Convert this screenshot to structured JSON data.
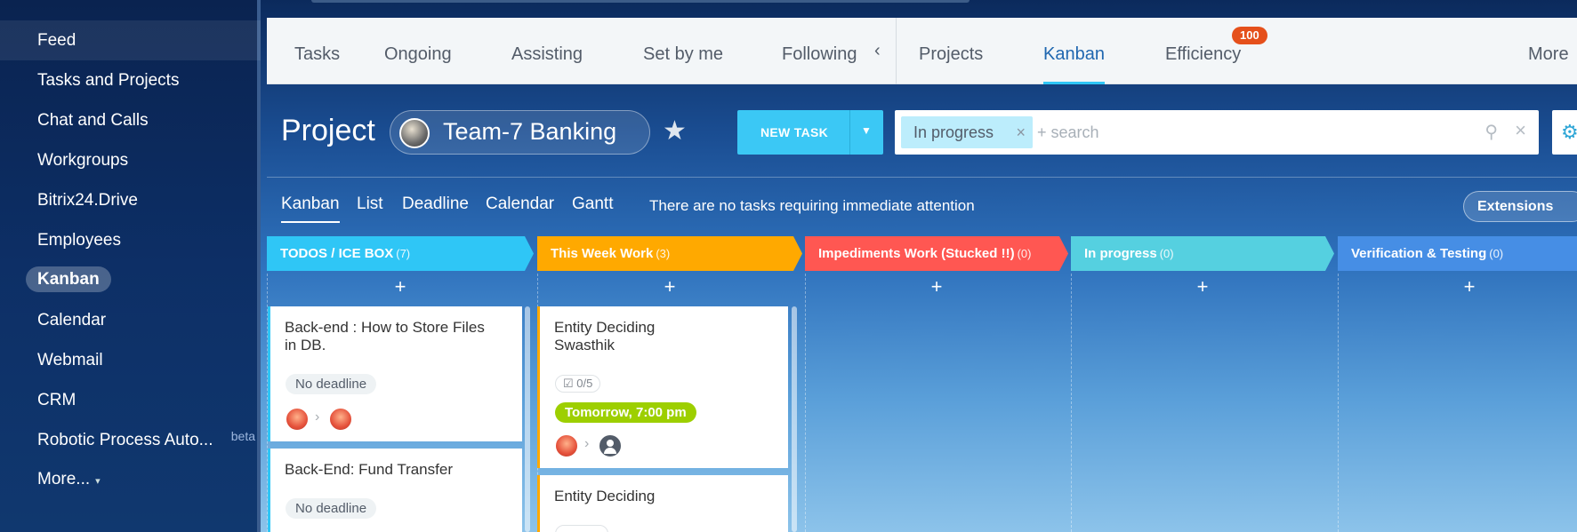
{
  "sidebar": {
    "items": [
      {
        "label": "Feed"
      },
      {
        "label": "Tasks and Projects"
      },
      {
        "label": "Chat and Calls"
      },
      {
        "label": "Workgroups"
      },
      {
        "label": "Bitrix24.Drive"
      },
      {
        "label": "Employees"
      },
      {
        "label": "Kanban"
      },
      {
        "label": "Calendar"
      },
      {
        "label": "Webmail"
      },
      {
        "label": "CRM"
      },
      {
        "label": "Robotic Process Auto...",
        "badge": "beta"
      },
      {
        "label": "More..."
      }
    ]
  },
  "topnav": {
    "tabs": [
      {
        "label": "Tasks"
      },
      {
        "label": "Ongoing"
      },
      {
        "label": "Assisting"
      },
      {
        "label": "Set by me"
      },
      {
        "label": "Following"
      },
      {
        "label": "Projects"
      },
      {
        "label": "Kanban"
      },
      {
        "label": "Efficiency"
      },
      {
        "label": "More"
      }
    ],
    "efficiency_badge": "100"
  },
  "header": {
    "title": "Project",
    "project_name": "Team-7 Banking",
    "new_task_label": "NEW TASK",
    "filter_chip": "In progress",
    "search_placeholder": "+ search"
  },
  "views": {
    "tabs": [
      {
        "label": "Kanban"
      },
      {
        "label": "List"
      },
      {
        "label": "Deadline"
      },
      {
        "label": "Calendar"
      },
      {
        "label": "Gantt"
      }
    ],
    "attention_text": "There are no tasks requiring immediate attention",
    "extensions_label": "Extensions"
  },
  "kanban": {
    "columns": [
      {
        "title": "TODOS / ICE BOX",
        "count": "(7)",
        "color": "#2fc6f6"
      },
      {
        "title": "This Week Work",
        "count": "(3)",
        "color": "#ffa900"
      },
      {
        "title": "Impediments Work (Stucked !!)",
        "count": "(0)",
        "color": "#ff5752"
      },
      {
        "title": "In progress",
        "count": "(0)",
        "color": "#55d0e0"
      },
      {
        "title": "Verification & Testing",
        "count": "(0)",
        "color": "#468ee5"
      }
    ],
    "add_symbol": "+",
    "cards": {
      "todo": [
        {
          "title": "Back-end : How to Store Files in DB.",
          "deadline": "No deadline"
        },
        {
          "title": "Back-End: Fund Transfer",
          "deadline": "No deadline"
        }
      ],
      "week": [
        {
          "title": "Entity Deciding Swasthik",
          "checklist": "0/5",
          "deadline": "Tomorrow, 7:00 pm"
        },
        {
          "title": "Entity Deciding"
        }
      ]
    }
  }
}
